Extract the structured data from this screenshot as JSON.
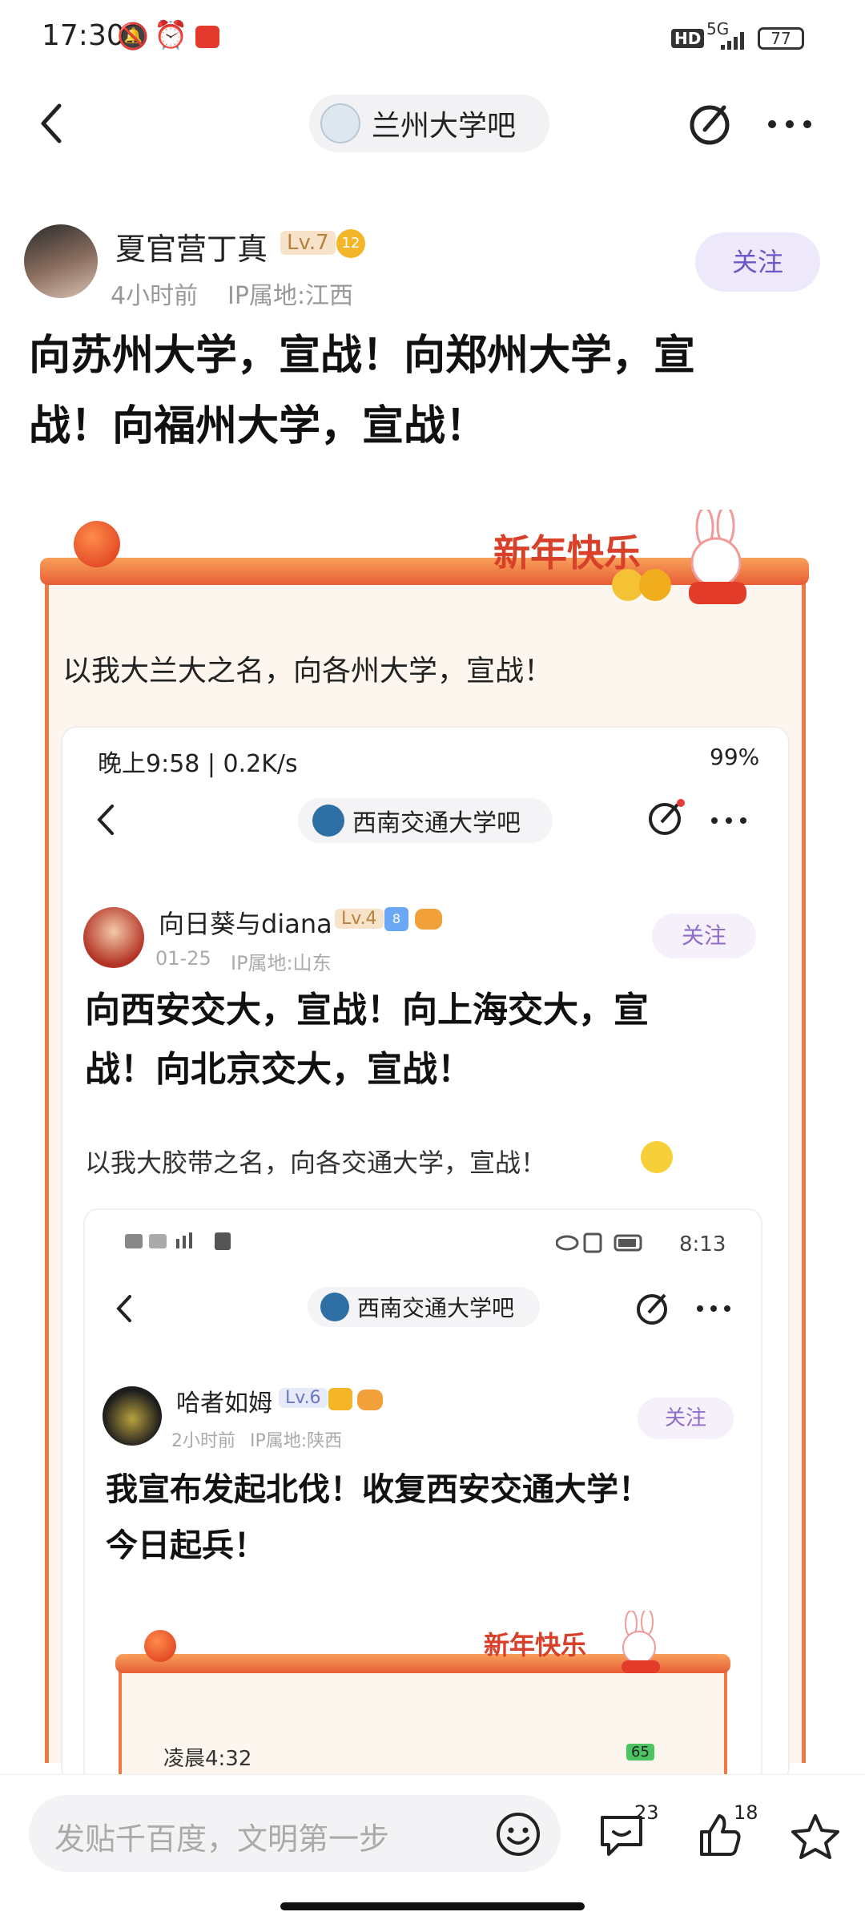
{
  "status": {
    "time": "17:30",
    "network": "5G",
    "battery": "77"
  },
  "header": {
    "forum_name": "兰州大学吧"
  },
  "post": {
    "author": "夏官营丁真",
    "level": "Lv.7",
    "badge": "12",
    "time": "4小时前",
    "ip": "IP属地:江西",
    "follow": "关注",
    "title_line1": "向苏州大学，宣战！向郑州大学，宣",
    "title_line2": "战！向福州大学，宣战！",
    "body": "以我大兰大之名，向各州大学，宣战！",
    "banner_text": "新年快乐"
  },
  "shot1": {
    "status_time": "晚上9:58 | 0.2K/s",
    "battery": "99%",
    "forum_name": "西南交通大学吧",
    "author": "向日葵与diana",
    "level": "Lv.4",
    "badge": "8",
    "time": "01-25",
    "ip": "IP属地:山东",
    "follow": "关注",
    "title_line1": "向西安交大，宣战！向上海交大，宣",
    "title_line2": "战！向北京交大，宣战！",
    "body": "以我大胶带之名，向各交通大学，宣战！"
  },
  "shot2": {
    "status_time": "8:13",
    "forum_name": "西南交通大学吧",
    "author": "哈者如姆",
    "level": "Lv.6",
    "time": "2小时前",
    "ip": "IP属地:陕西",
    "follow": "关注",
    "title_line1": "我宣布发起北伐！收复西安交通大学！",
    "title_line2": "今日起兵！",
    "banner_text": "新年快乐"
  },
  "shot3": {
    "status_time": "凌晨4:32",
    "battery": "65"
  },
  "bottom": {
    "input_placeholder": "发贴千百度，文明第一步",
    "comment_count": "23",
    "like_count": "18"
  }
}
